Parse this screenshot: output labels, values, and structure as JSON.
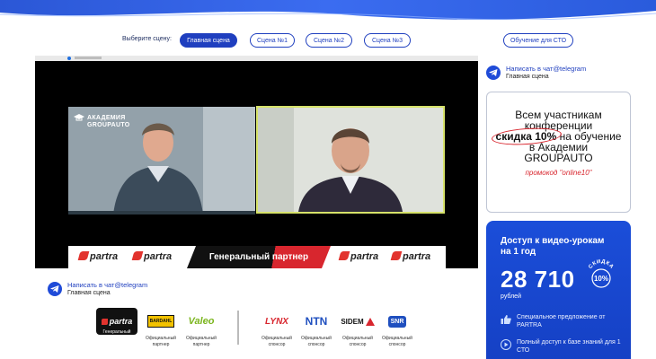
{
  "scene_selector": {
    "label": "Выберите сцену:",
    "scenes": [
      {
        "label": "Главная сцена",
        "active": true
      },
      {
        "label": "Сцена №1",
        "active": false
      },
      {
        "label": "Сцена №2",
        "active": false
      },
      {
        "label": "Сцена №3",
        "active": false
      }
    ],
    "extra_button": "Обучение для СТО"
  },
  "video": {
    "overlay_title_line1": "АКАДЕМИЯ",
    "overlay_title_line2": "GROUPAUTO",
    "partner_band": {
      "brand": "partra",
      "center_label": "Генеральный партнер"
    }
  },
  "telegram_top": {
    "link": "Написать в чат@telegram",
    "sub": "Главная сцена"
  },
  "telegram_bottom": {
    "link": "Написать в чат@telegram",
    "sub": "Главная сцена"
  },
  "promo": {
    "line1": "Всем участникам конференции",
    "highlight": "скидка 10%",
    "line2": "на обучение в Академии GROUPAUTO",
    "code": "промокод \"online10\""
  },
  "offer": {
    "title": "Доступ к видео-урокам на 1 год",
    "price": "28 710",
    "currency": "рублей",
    "badge_top": "СКИДКА",
    "badge_value": "10%",
    "items": [
      {
        "icon": "thumbs-up-icon",
        "text": "Специальное предложение от PARTRA"
      },
      {
        "icon": "play-icon",
        "text": "Полный доступ к базе знаний для 1 СТО"
      }
    ]
  },
  "sponsors": [
    {
      "logo": "partra",
      "caption_line1": "Генеральный",
      "caption_line2": "партнер"
    },
    {
      "logo": "BARDAHL",
      "caption_line1": "Официальный",
      "caption_line2": "партнер"
    },
    {
      "logo": "Valeo",
      "caption_line1": "Официальный",
      "caption_line2": "партнер"
    },
    {
      "logo": "LYNX",
      "caption_line1": "Официальный",
      "caption_line2": "спонсор"
    },
    {
      "logo": "NTN",
      "caption_line1": "Официальный",
      "caption_line2": "спонсор"
    },
    {
      "logo": "SIDEM",
      "caption_line1": "Официальный",
      "caption_line2": "спонсор"
    },
    {
      "logo": "SNR",
      "caption_line1": "Официальный",
      "caption_line2": "спонсор"
    }
  ],
  "colors": {
    "primary_blue": "#1f3fbf",
    "card_blue": "#1b4ed9",
    "accent_red": "#d8262e",
    "telegram_blue": "#1f4bd8"
  }
}
